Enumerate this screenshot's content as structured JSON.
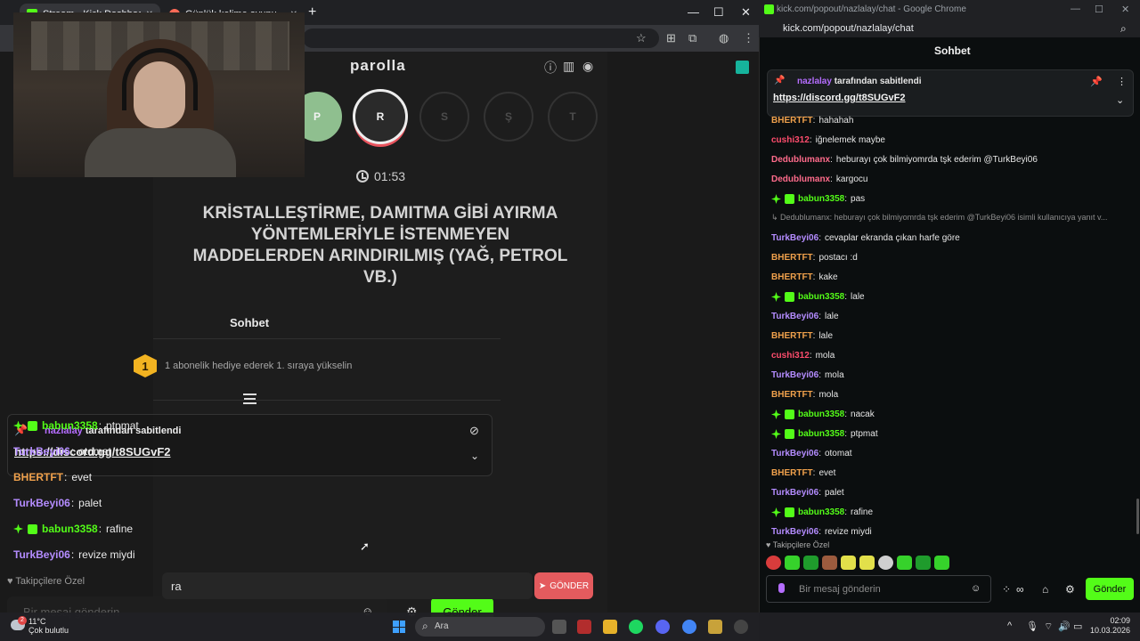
{
  "left_browser": {
    "tabs": [
      {
        "label": "Stream - Kick Dashboard",
        "close": "✕"
      },
      {
        "label": "Günlük kelime oyunu - parolla",
        "close": "✕"
      }
    ],
    "new_tab": "+",
    "window_controls": [
      "—",
      "☐",
      "✕"
    ]
  },
  "game": {
    "title": "parolla",
    "letters": [
      {
        "letter": "P",
        "state": "done"
      },
      {
        "letter": "R",
        "state": "active"
      },
      {
        "letter": "S",
        "state": "pending"
      },
      {
        "letter": "Ş",
        "state": "pending"
      },
      {
        "letter": "T",
        "state": "pending"
      }
    ],
    "timer": "01:53",
    "question": "KRİSTALLEŞTİRME, DAMITMA GİBİ AYIRMA YÖNTEMLERİYLE İSTENMEYEN MADDELERDEN ARINDIRILMIŞ (YAĞ, PETROL VB.)",
    "answer_value": "ra",
    "send_label": "GÖNDER"
  },
  "overlay_chat": {
    "title": "Sohbet",
    "gift_rank": "1",
    "gift_text": "1 abonelik hediye ederek 1. sıraya yükselin",
    "pinned_user": "nazlalay",
    "pinned_suffix": "tarafından sabitlendi",
    "pinned_link": "https://discord.gg/t8SUGvF2",
    "messages": [
      {
        "user": "babun3358",
        "text": "ptpmat",
        "color": "#53fc18",
        "badges": true
      },
      {
        "user": "TurkBeyi06",
        "text": "otomat",
        "color": "#b48cff",
        "badges": false
      },
      {
        "user": "BHERTFT",
        "text": "evet",
        "color": "#f0a14c",
        "badges": false
      },
      {
        "user": "TurkBeyi06",
        "text": "palet",
        "color": "#b48cff",
        "badges": false
      },
      {
        "user": "babun3358",
        "text": "rafine",
        "color": "#53fc18",
        "badges": true
      },
      {
        "user": "TurkBeyi06",
        "text": "revize miydi",
        "color": "#b48cff",
        "badges": false
      }
    ],
    "followers_only": "Takipçilere Özel",
    "input_placeholder": "Bir mesaj gönderin",
    "send_label": "Gönder"
  },
  "taskbar": {
    "temp": "11°C",
    "weather": "Çok bulutlu",
    "badge": "2",
    "search": "Ara",
    "time": "02:09",
    "date": "10.03.2026"
  },
  "right_window": {
    "title": "kick.com/popout/nazlalay/chat - Google Chrome",
    "url": "kick.com/popout/nazlalay/chat",
    "header": "Sohbet",
    "pinned_user": "nazlalay",
    "pinned_suffix": "tarafından sabitlendi",
    "pinned_link": "https://discord.gg/t8SUGvF2",
    "reply_context": "↳ Dedublumanx: heburayı çok bilmiyomrda tşk ederim @TurkBeyi06 isimli kullanıcıya yanıt v...",
    "messages": [
      {
        "user": "BHERTFT",
        "text": "hahahah",
        "color": "#f0a14c",
        "badges": false
      },
      {
        "user": "cushi312",
        "text": "iğnelemek maybe",
        "color": "#ff4d6d",
        "badges": false
      },
      {
        "user": "Dedublumanx",
        "text": "heburayı çok bilmiyomrda tşk ederim @TurkBeyi06",
        "color": "#ff6b8b",
        "badges": false
      },
      {
        "user": "Dedublumanx",
        "text": "kargocu",
        "color": "#ff6b8b",
        "badges": false
      },
      {
        "user": "babun3358",
        "text": "pas",
        "color": "#53fc18",
        "badges": true
      },
      {
        "user": "TurkBeyi06",
        "text": "cevaplar ekranda çıkan harfe göre",
        "color": "#b48cff",
        "badges": false
      },
      {
        "user": "BHERTFT",
        "text": "postacı :d",
        "color": "#f0a14c",
        "badges": false
      },
      {
        "user": "BHERTFT",
        "text": "kake",
        "color": "#f0a14c",
        "badges": false
      },
      {
        "user": "babun3358",
        "text": "lale",
        "color": "#53fc18",
        "badges": true
      },
      {
        "user": "TurkBeyi06",
        "text": "lale",
        "color": "#b48cff",
        "badges": false
      },
      {
        "user": "BHERTFT",
        "text": "lale",
        "color": "#f0a14c",
        "badges": false
      },
      {
        "user": "cushi312",
        "text": "mola",
        "color": "#ff4d6d",
        "badges": false
      },
      {
        "user": "TurkBeyi06",
        "text": "mola",
        "color": "#b48cff",
        "badges": false
      },
      {
        "user": "BHERTFT",
        "text": "mola",
        "color": "#f0a14c",
        "badges": false
      },
      {
        "user": "babun3358",
        "text": "nacak",
        "color": "#53fc18",
        "badges": true
      },
      {
        "user": "babun3358",
        "text": "ptpmat",
        "color": "#53fc18",
        "badges": true
      },
      {
        "user": "TurkBeyi06",
        "text": "otomat",
        "color": "#b48cff",
        "badges": false
      },
      {
        "user": "BHERTFT",
        "text": "evet",
        "color": "#f0a14c",
        "badges": false
      },
      {
        "user": "TurkBeyi06",
        "text": "palet",
        "color": "#b48cff",
        "badges": false
      },
      {
        "user": "babun3358",
        "text": "rafine",
        "color": "#53fc18",
        "badges": true
      },
      {
        "user": "TurkBeyi06",
        "text": "revize miydi",
        "color": "#b48cff",
        "badges": false
      }
    ],
    "followers_only": "Takipçilere Özel",
    "input_placeholder": "Bir mesaj gönderin",
    "send_label": "Gönder"
  }
}
